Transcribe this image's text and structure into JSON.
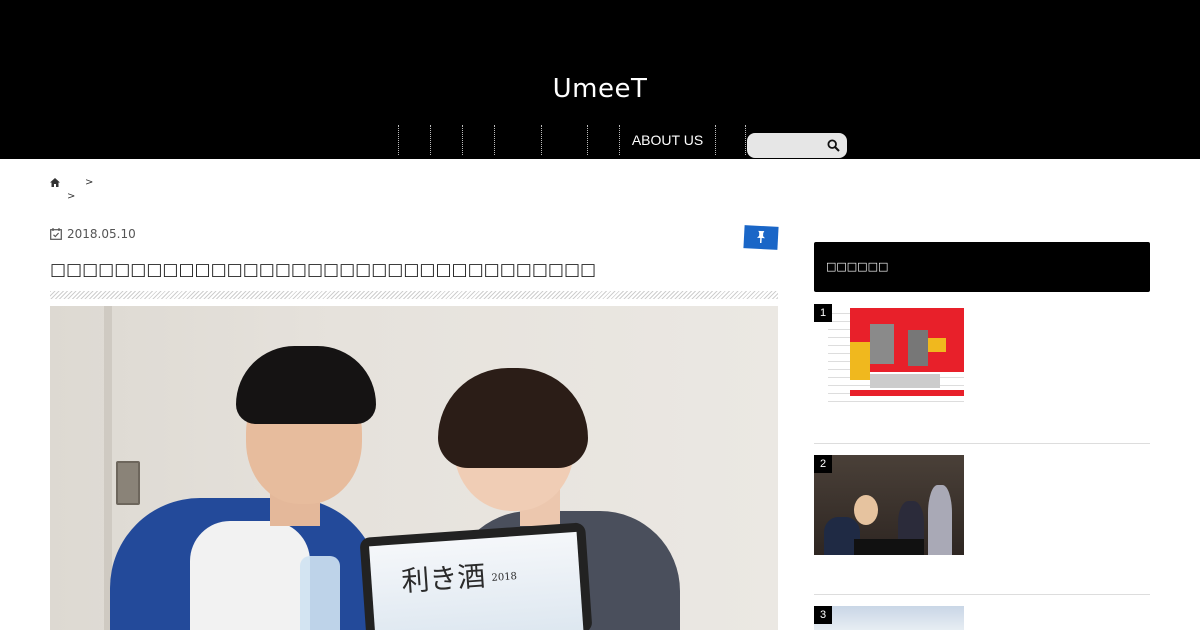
{
  "header": {
    "site_title": "UmeeT",
    "nav_items": [
      "",
      "",
      "",
      "",
      "",
      "",
      "ABOUT US",
      ""
    ],
    "search_placeholder": ""
  },
  "breadcrumb": {
    "separator_1": ">",
    "separator_2": ">"
  },
  "post": {
    "date": "2018.05.10",
    "title": "□□□□□□□□□□□□□□□□□□□□□□□□□□□□□□□□□□",
    "hero_screen_title": "利き酒",
    "hero_screen_year": "2018"
  },
  "sidebar": {
    "heading": "□□□□□□",
    "ranking": [
      {
        "rank": "1"
      },
      {
        "rank": "2"
      },
      {
        "rank": "3"
      }
    ]
  },
  "colors": {
    "header_bg": "#000000",
    "pin_badge": "#1a66c7",
    "sidebar_heading_bg": "#000000"
  },
  "icons": {
    "home": "home-icon",
    "calendar": "calendar-icon",
    "pin": "pin-icon",
    "search": "search-icon"
  }
}
